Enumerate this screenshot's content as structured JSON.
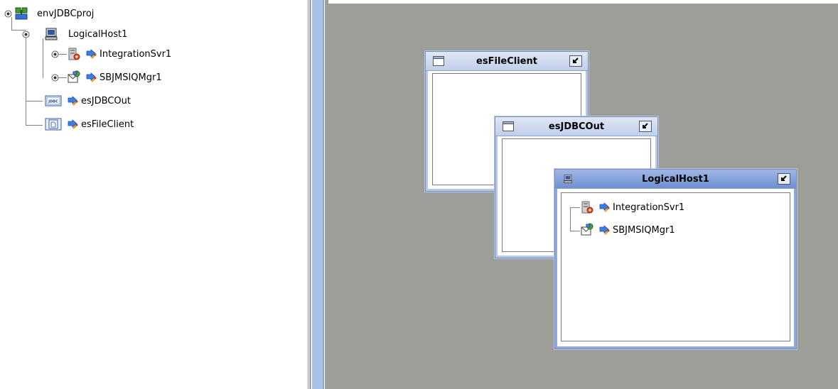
{
  "tree": {
    "root": {
      "label": "envJDBCproj",
      "icon": "environment-icon"
    },
    "host": {
      "label": "LogicalHost1",
      "icon": "computer-icon"
    },
    "children": [
      {
        "label": "IntegrationSvr1",
        "icon": "server-icon"
      },
      {
        "label": "SBJMSIQMgr1",
        "icon": "message-server-icon"
      }
    ],
    "externals": [
      {
        "label": "esJDBCOut",
        "icon": "jdbc-external-icon",
        "badge": "JDBC"
      },
      {
        "label": "esFileClient",
        "icon": "file-external-icon"
      }
    ]
  },
  "canvas": {
    "windows": {
      "fileclient": {
        "title": "esFileClient"
      },
      "jdbcout": {
        "title": "esJDBCOut"
      },
      "logicalhost": {
        "title": "LogicalHost1",
        "items": [
          {
            "label": "IntegrationSvr1",
            "icon": "server-icon"
          },
          {
            "label": "SBJMSIQMgr1",
            "icon": "message-server-icon"
          }
        ]
      }
    }
  },
  "colors": {
    "canvas": "#9e9e98",
    "window_border": "#b5c6e6",
    "active_title": "#6e8fd0"
  }
}
